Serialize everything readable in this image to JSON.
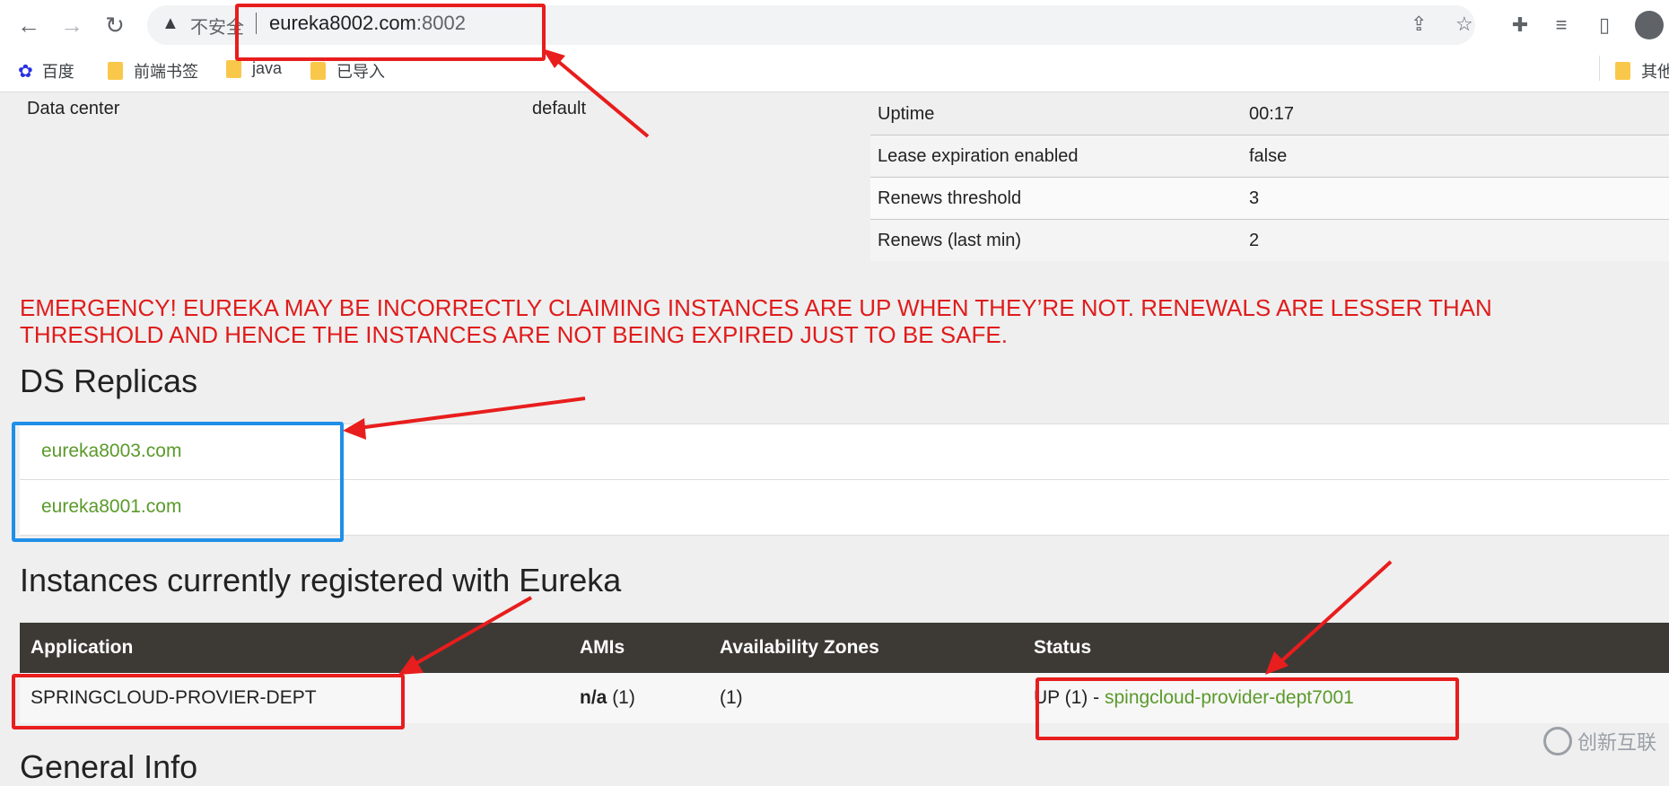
{
  "browser": {
    "security_label": "不安全",
    "url_host": "eureka8002.com",
    "url_port": ":8002",
    "bookmarks": [
      "百度",
      "前端书签",
      "java",
      "已导入"
    ],
    "bookmarks_overflow": "其他"
  },
  "system": {
    "data_center_label": "Data center",
    "data_center_value": "default",
    "stats": [
      {
        "key": "Uptime",
        "value": "00:17"
      },
      {
        "key": "Lease expiration enabled",
        "value": "false"
      },
      {
        "key": "Renews threshold",
        "value": "3"
      },
      {
        "key": "Renews (last min)",
        "value": "2"
      }
    ]
  },
  "emergency_message": "EMERGENCY! EUREKA MAY BE INCORRECTLY CLAIMING INSTANCES ARE UP WHEN THEY’RE NOT. RENEWALS ARE LESSER THAN THRESHOLD AND HENCE THE INSTANCES ARE NOT BEING EXPIRED JUST TO BE SAFE.",
  "replicas": {
    "title": "DS Replicas",
    "items": [
      "eureka8003.com",
      "eureka8001.com"
    ]
  },
  "instances": {
    "title": "Instances currently registered with Eureka",
    "columns": [
      "Application",
      "AMIs",
      "Availability Zones",
      "Status"
    ],
    "rows": [
      {
        "application": "SPRINGCLOUD-PROVIER-DEPT",
        "amis_bold": "n/a",
        "amis_count": "(1)",
        "zones": "(1)",
        "status_prefix": "UP (1) - ",
        "status_link": "spingcloud-provider-dept7001"
      }
    ]
  },
  "next_section_title": "General Info",
  "watermark": "创新互联",
  "colors": {
    "emergency": "#e01c1c",
    "link": "#5a9a2a",
    "table_header": "#3d3a36",
    "annotation_red": "#e81d1d",
    "annotation_blue": "#1f8fe8"
  }
}
